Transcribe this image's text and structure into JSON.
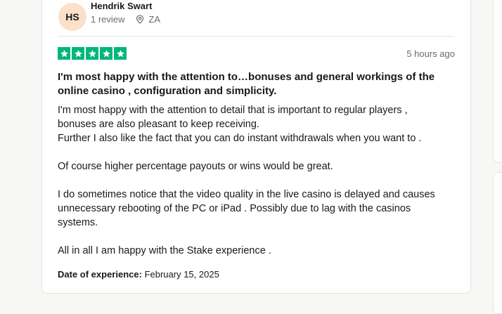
{
  "reviewer": {
    "initials": "HS",
    "name": "Hendrik Swart",
    "review_count": "1 review",
    "country": "ZA"
  },
  "review": {
    "rating": 5,
    "rating_color": "#00b67a",
    "posted": "5 hours ago",
    "title": "I'm most happy with the attention to…bonuses and general workings of the online casino , configuration and simplicity.",
    "paragraphs": [
      "I'm most happy with the attention to detail that is important to regular players ,\nbonuses are also pleasant to keep receiving.\nFurther I also like the fact that you can do instant withdrawals when you want to .",
      "Of course higher percentage payouts or wins would be great.",
      "I do sometimes notice that the video quality in the live casino is delayed and causes unnecessary rebooting of the PC or iPad . Possibly due to lag with the casinos systems.",
      "All in all I am happy with the Stake experience ."
    ],
    "date_label": "Date of experience:",
    "date_value": "February 15, 2025"
  },
  "icons": {
    "location": "location-pin-icon",
    "star": "star-icon"
  }
}
